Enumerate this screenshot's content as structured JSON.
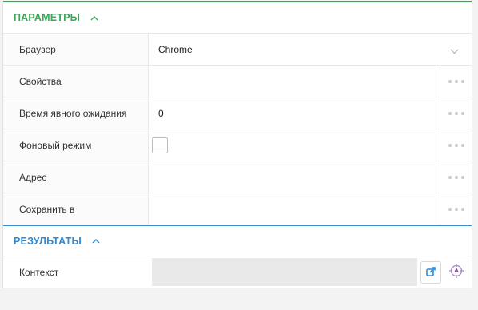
{
  "parameters": {
    "title": "ПАРАМЕТРЫ",
    "rows": [
      {
        "label": "Браузер",
        "value": "Chrome",
        "kind": "select"
      },
      {
        "label": "Свойства",
        "value": "",
        "kind": "text"
      },
      {
        "label": "Время явного ожидания",
        "value": "0",
        "kind": "text"
      },
      {
        "label": "Фоновый режим",
        "value": "",
        "kind": "checkbox"
      },
      {
        "label": "Адрес",
        "value": "",
        "kind": "text"
      },
      {
        "label": "Сохранить в",
        "value": "",
        "kind": "text"
      }
    ]
  },
  "results": {
    "title": "РЕЗУЛЬТАТЫ",
    "rows": [
      {
        "label": "Контекст",
        "value": ""
      }
    ]
  },
  "colors": {
    "params_accent": "#3aa857",
    "results_accent": "#2b8ad8",
    "icon_purple": "#8e44ad"
  },
  "icons": {
    "collapse": "chevron-up-icon",
    "more": "ellipsis-icon",
    "select": "chevron-down-icon",
    "export": "export-icon",
    "locate": "crosshair-icon"
  }
}
